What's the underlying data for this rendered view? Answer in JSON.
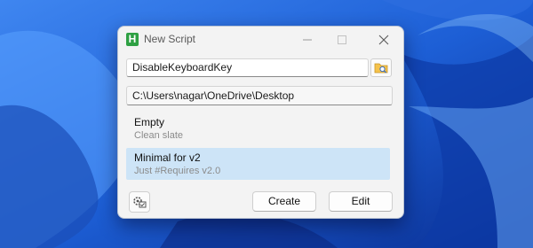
{
  "window": {
    "title": "New Script",
    "app_icon_letter": "H"
  },
  "name_field": {
    "value": "DisableKeyboardKey"
  },
  "path_field": {
    "value": "C:\\Users\\nagar\\OneDrive\\Desktop"
  },
  "templates": [
    {
      "name": "Empty",
      "description": "Clean slate",
      "selected": false
    },
    {
      "name": "Minimal for v2",
      "description": "Just #Requires v2.0",
      "selected": true
    }
  ],
  "buttons": {
    "create": "Create",
    "edit": "Edit"
  },
  "icons": {
    "browse": "folder-search-icon",
    "settings": "gear-checkbox-icon"
  },
  "colors": {
    "accent_selection": "#cde4f7",
    "app_icon": "#2ea043",
    "wallpaper": "#1a56c8"
  }
}
